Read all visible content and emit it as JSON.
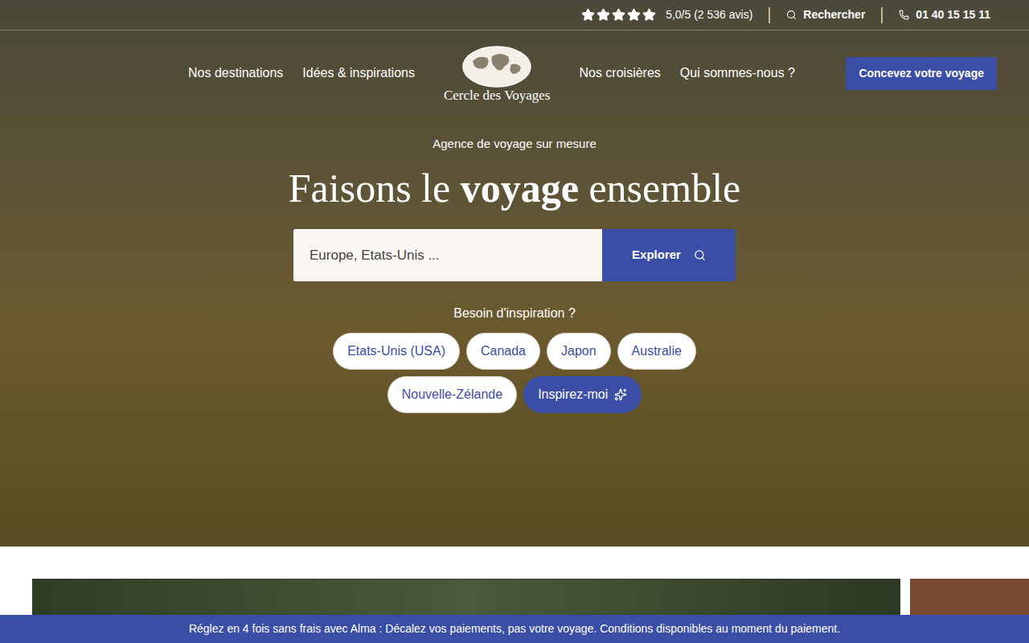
{
  "top_bar": {
    "rating": {
      "stars": 5,
      "max_stars": 5,
      "text": "5,0/5 (2 536 avis)"
    },
    "search": "Rechercher",
    "phone": "01 40 15 15 11"
  },
  "nav": {
    "left": [
      "Nos destinations",
      "Idées & inspirations"
    ],
    "logo": "Cercle des Voyages",
    "right": [
      "Nos croisières",
      "Qui sommes-nous ?"
    ],
    "cta": "Concevez votre voyage"
  },
  "hero": {
    "eyebrow": "Agence de voyage sur mesure",
    "heading": [
      {
        "text": "Faisons le ",
        "bold": false
      },
      {
        "text": "voyage",
        "bold": true
      },
      {
        "text": " ensemble",
        "bold": false
      }
    ],
    "search": {
      "placeholder": "Europe, Etats-Unis ...",
      "button": "Explorer"
    },
    "inspiration_label": "Besoin d'inspiration ?",
    "chips": [
      {
        "label": "Etats-Unis (USA)",
        "kind": "destination"
      },
      {
        "label": "Canada",
        "kind": "destination"
      },
      {
        "label": "Japon",
        "kind": "destination"
      },
      {
        "label": "Australie",
        "kind": "destination"
      },
      {
        "label": "Nouvelle-Zélande",
        "kind": "destination"
      },
      {
        "label": "Inspirez-moi",
        "kind": "action"
      }
    ]
  },
  "banner": "Réglez en 4 fois sans frais avec Alma : Décalez vos paiements, pas votre voyage. Conditions disponibles au moment du paiement."
}
